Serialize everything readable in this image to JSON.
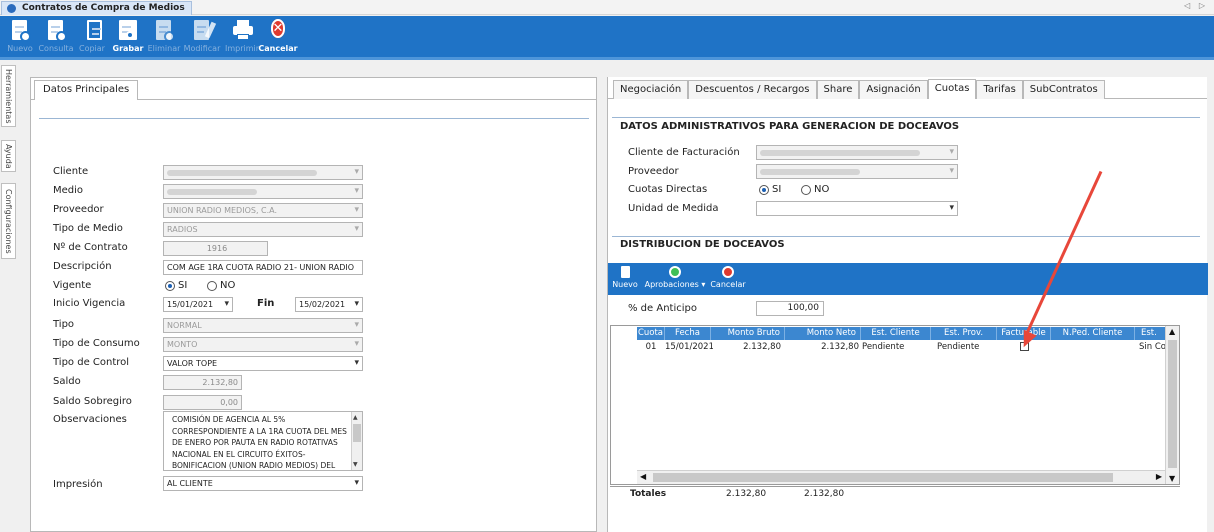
{
  "window": {
    "title": "Contratos de Compra de Medios",
    "nav": "◁ ▷"
  },
  "toolbar": {
    "nuevo": "Nuevo",
    "consulta": "Consulta",
    "copiar": "Copiar",
    "grabar": "Grabar",
    "eliminar": "Eliminar",
    "modificar": "Modificar",
    "imprimir": "Imprimir",
    "cancelar": "Cancelar"
  },
  "side_tabs": {
    "herramientas": "Herramientas",
    "ayuda": "Ayuda",
    "configuraciones": "Configuraciones"
  },
  "left": {
    "tab": "Datos Principales",
    "labels": {
      "cliente": "Cliente",
      "medio": "Medio",
      "proveedor": "Proveedor",
      "tipo_medio": "Tipo de Medio",
      "num_contrato": "Nº de Contrato",
      "descripcion": "Descripción",
      "vigente": "Vigente",
      "inicio_vigencia": "Inicio Vigencia",
      "fin": "Fin",
      "tipo": "Tipo",
      "tipo_consumo": "Tipo de Consumo",
      "tipo_control": "Tipo de Control",
      "saldo": "Saldo",
      "saldo_sobregiro": "Saldo Sobregiro",
      "observaciones": "Observaciones",
      "impresion": "Impresión"
    },
    "values": {
      "proveedor": "UNION RADIO MEDIOS, C.A.",
      "tipo_medio": "RADIOS",
      "num_contrato": "1916",
      "descripcion": "COM AGE 1RA CUOTA RADIO 21- UNION RADIO",
      "vigente_si": "SI",
      "vigente_no": "NO",
      "inicio_vigencia": "15/01/2021",
      "fin": "15/02/2021",
      "tipo": "NORMAL",
      "tipo_consumo": "MONTO",
      "tipo_control": "VALOR TOPE",
      "saldo": "2.132,80",
      "saldo_sobregiro": "0,00",
      "observaciones": "COMISIÓN DE AGENCIA AL 5% CORRESPONDIENTE A LA 1RA CUOTA DEL MES DE ENERO POR PAUTA EN RADIO ROTATIVAS NACIONAL EN EL CIRCUITO ÉXITOS- BONIFICACION (UNION RADIO MEDIOS) DEL",
      "impresion": "AL CLIENTE"
    }
  },
  "right": {
    "tabs": [
      "Negociación",
      "Descuentos / Recargos",
      "Share",
      "Asignación",
      "Cuotas",
      "Tarifas",
      "SubContratos"
    ],
    "active_tab": "Cuotas",
    "admin_title": "DATOS ADMINISTRATIVOS PARA GENERACION DE DOCEAVOS",
    "labels": {
      "cliente_fact": "Cliente de Facturación",
      "proveedor": "Proveedor",
      "cuotas_directas": "Cuotas Directas",
      "unidad_medida": "Unidad de Medida"
    },
    "cuotas_si": "SI",
    "cuotas_no": "NO",
    "dist_title": "DISTRIBUCION DE DOCEAVOS",
    "grid_toolbar": {
      "nuevo": "Nuevo",
      "aprobaciones": "Aprobaciones ▾",
      "cancelar": "Cancelar"
    },
    "anticipo_label": "% de Anticipo",
    "anticipo_value": "100,00",
    "columns": [
      "Cuota",
      "Fecha",
      "Monto Bruto",
      "Monto Neto",
      "Est. Cliente",
      "Est. Prov.",
      "Facturable",
      "N.Ped. Cliente",
      "Est."
    ],
    "rows": [
      {
        "cuota": "01",
        "fecha": "15/01/2021",
        "bruto": "2.132,80",
        "neto": "2.132,80",
        "est_cliente": "Pendiente",
        "est_prov": "Pendiente",
        "facturable": false,
        "nped": "",
        "est": "Sin Co"
      }
    ],
    "totales_label": "Totales",
    "total_bruto": "2.132,80",
    "total_neto": "2.132,80"
  },
  "colors": {
    "toolbar": "#1f73c6",
    "accent_arrow": "#e8473a",
    "grid_header": "#3c87d0"
  }
}
